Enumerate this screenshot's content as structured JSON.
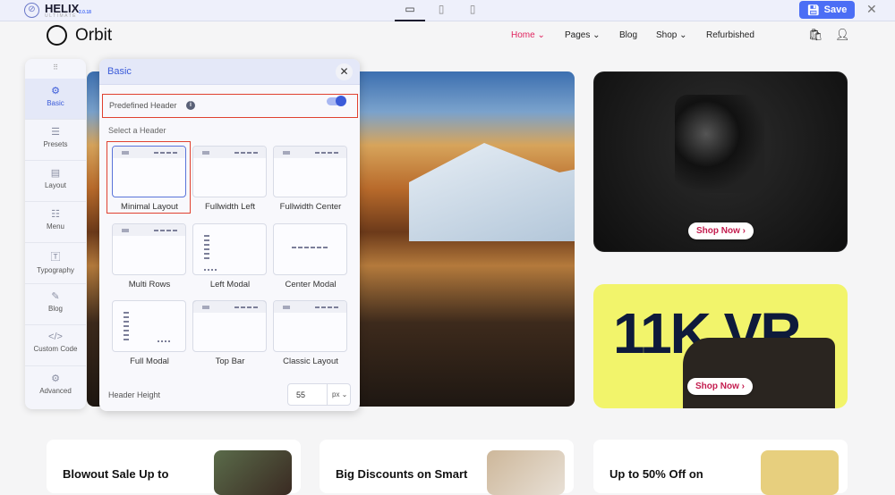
{
  "topbar": {
    "brand": "HELIX",
    "brand_sub": "ULTIMATE",
    "version": "2.0.18",
    "save_label": "Save",
    "devices": [
      "desktop",
      "tablet",
      "mobile"
    ]
  },
  "site": {
    "logo": "Orbit",
    "nav": [
      {
        "label": "Home",
        "active": true,
        "dropdown": true
      },
      {
        "label": "Pages",
        "dropdown": true
      },
      {
        "label": "Blog"
      },
      {
        "label": "Shop",
        "dropdown": true
      },
      {
        "label": "Refurbished"
      }
    ]
  },
  "promo": {
    "camera_cta": "Shop Now",
    "vr_title": "11K VR",
    "vr_cta": "Shop Now"
  },
  "bottom_cards": [
    "Blowout Sale Up to",
    "Big Discounts on Smart",
    "Up to 50% Off on"
  ],
  "sidebar": {
    "items": [
      "Basic",
      "Presets",
      "Layout",
      "Menu",
      "Typography",
      "Blog",
      "Custom Code",
      "Advanced"
    ],
    "active": "Basic"
  },
  "panel": {
    "title": "Basic",
    "predefined_label": "Predefined Header",
    "predefined_on": true,
    "select_label": "Select a Header",
    "headers": [
      "Minimal Layout",
      "Fullwidth Left",
      "Fullwidth Center",
      "Multi Rows",
      "Left Modal",
      "Center Modal",
      "Full Modal",
      "Top Bar",
      "Classic Layout"
    ],
    "selected": "Minimal Layout",
    "height_label": "Header Height",
    "height_value": "55",
    "height_unit": "px"
  },
  "colors": {
    "accent": "#4b6ef5",
    "nav_active": "#e0245e",
    "highlight": "#e0412f",
    "vr_bg": "#f2f46b"
  }
}
